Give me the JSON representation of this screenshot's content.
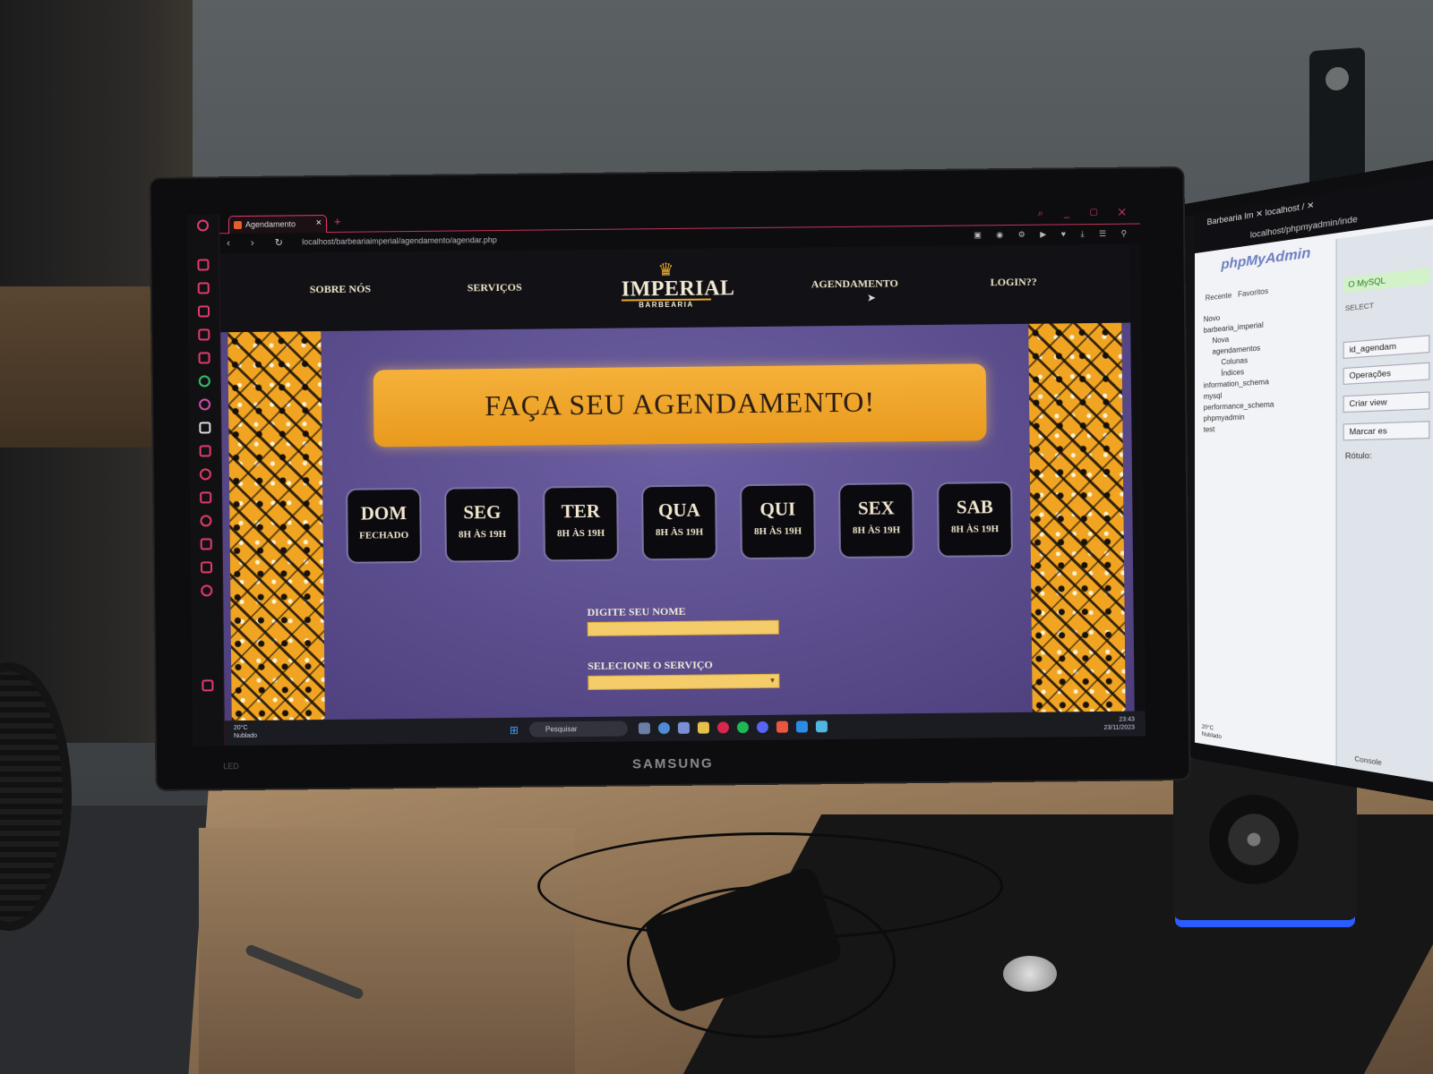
{
  "browser": {
    "tab_title": "Agendamento",
    "tab_close": "×",
    "new_tab": "+",
    "window_controls": "⌕ _ ▢ ✕",
    "nav_buttons": "‹ › ↻",
    "url": "localhost/barbeariaimperial/agendamento/agendar.php"
  },
  "site": {
    "nav": {
      "about": "SOBRE NÓS",
      "services": "SERVIÇOS",
      "scheduling": "AGENDAMENTO",
      "login": "LOGIN??"
    },
    "logo": {
      "crown": "♛",
      "name": "IMPERIAL",
      "subtitle": "BARBEARIA"
    },
    "banner": "FAÇA SEU AGENDAMENTO!",
    "days": [
      {
        "name": "DOM",
        "hours": "FECHADO"
      },
      {
        "name": "SEG",
        "hours": "8H ÀS 19H"
      },
      {
        "name": "TER",
        "hours": "8H ÀS 19H"
      },
      {
        "name": "QUA",
        "hours": "8H ÀS 19H"
      },
      {
        "name": "QUI",
        "hours": "8H ÀS 19H"
      },
      {
        "name": "SEX",
        "hours": "8H ÀS 19H"
      },
      {
        "name": "SAB",
        "hours": "8H ÀS 19H"
      }
    ],
    "form": {
      "name_label": "DIGITE SEU NOME",
      "name_value": "",
      "service_label": "SELECIONE O SERVIÇO",
      "service_value": ""
    },
    "colors": {
      "accent": "#f0a422",
      "background": "#5a4b8a",
      "nav": "#111116",
      "card": "#0b0a0e"
    }
  },
  "taskbar": {
    "weather_temp": "20°C",
    "weather_desc": "Nublado",
    "search_placeholder": "Pesquisar",
    "time": "23:43",
    "date": "23/11/2023"
  },
  "monitor": {
    "brand": "SAMSUNG",
    "led_label": "LED"
  },
  "second_screen": {
    "tabs": "Barbearia Im ✕   localhost / ✕",
    "url": "localhost/phpmyadmin/inde",
    "logo": "phpMyAdmin",
    "recent": "Recente",
    "favorites": "Favoritos",
    "tree": [
      "Novo",
      "barbearia_imperial",
      "Nova",
      "agendamentos",
      "Colunas",
      "Índices",
      "information_schema",
      "mysql",
      "performance_schema",
      "phpmyadmin",
      "test"
    ],
    "status": "O MySQL",
    "select": "SELECT",
    "table_name": "id_agendam",
    "operations": "Operações",
    "create_view": "Criar view",
    "mark": "Marcar es",
    "label": "Rótulo:",
    "console": "Console",
    "weather_temp": "20°C",
    "weather_desc": "Nublado"
  }
}
